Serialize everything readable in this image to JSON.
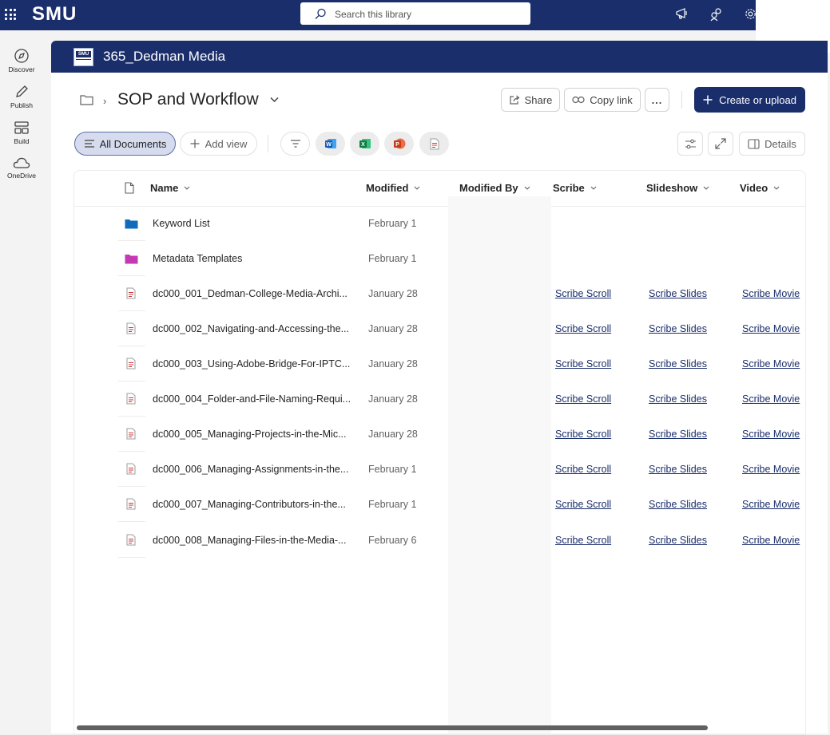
{
  "topbar": {
    "brand": "SMU",
    "search_placeholder": "Search this library",
    "icons": [
      "app-launcher-icon",
      "megaphone-icon",
      "share-people-icon",
      "gear-icon"
    ]
  },
  "leftrail": {
    "items": [
      {
        "label": "Discover",
        "icon": "compass-icon"
      },
      {
        "label": "Publish",
        "icon": "pen-icon"
      },
      {
        "label": "Build",
        "icon": "layout-icon"
      },
      {
        "label": "OneDrive",
        "icon": "cloud-icon"
      }
    ]
  },
  "site": {
    "logo_text": "SMU",
    "title": "365_Dedman Media"
  },
  "breadcrumb": {
    "title": "SOP and Workflow"
  },
  "actions": {
    "share": "Share",
    "copy_link": "Copy link",
    "more": "...",
    "create": "Create or upload"
  },
  "views": {
    "active": "All Documents",
    "add": "Add view",
    "details": "Details"
  },
  "table": {
    "headers": {
      "name": "Name",
      "modified": "Modified",
      "modified_by": "Modified By",
      "scribe": "Scribe",
      "slideshow": "Slideshow",
      "video": "Video"
    },
    "rows": [
      {
        "type": "folder",
        "color": "#0f6cbd",
        "name": "Keyword List",
        "modified": "February 1",
        "scribe": "",
        "slides": "",
        "video": ""
      },
      {
        "type": "folder",
        "color": "#c239b3",
        "name": "Metadata Templates",
        "modified": "February 1",
        "scribe": "",
        "slides": "",
        "video": ""
      },
      {
        "type": "pdf",
        "name": "dc000_001_Dedman-College-Media-Archi...",
        "modified": "January 28",
        "scribe": "Scribe Scroll",
        "slides": "Scribe Slides",
        "video": "Scribe Movie"
      },
      {
        "type": "pdf",
        "name": "dc000_002_Navigating-and-Accessing-the...",
        "modified": "January 28",
        "scribe": "Scribe Scroll",
        "slides": "Scribe Slides",
        "video": "Scribe Movie"
      },
      {
        "type": "pdf",
        "name": "dc000_003_Using-Adobe-Bridge-For-IPTC...",
        "modified": "January 28",
        "scribe": "Scribe Scroll",
        "slides": "Scribe Slides",
        "video": "Scribe Movie"
      },
      {
        "type": "pdf",
        "name": "dc000_004_Folder-and-File-Naming-Requi...",
        "modified": "January 28",
        "scribe": "Scribe Scroll",
        "slides": "Scribe Slides",
        "video": "Scribe Movie"
      },
      {
        "type": "pdf",
        "name": "dc000_005_Managing-Projects-in-the-Mic...",
        "modified": "January 28",
        "scribe": "Scribe Scroll",
        "slides": "Scribe Slides",
        "video": "Scribe Movie"
      },
      {
        "type": "pdf",
        "name": "dc000_006_Managing-Assignments-in-the...",
        "modified": "February 1",
        "scribe": "Scribe Scroll",
        "slides": "Scribe Slides",
        "video": "Scribe Movie"
      },
      {
        "type": "pdf",
        "name": "dc000_007_Managing-Contributors-in-the...",
        "modified": "February 1",
        "scribe": "Scribe Scroll",
        "slides": "Scribe Slides",
        "video": "Scribe Movie"
      },
      {
        "type": "pdf",
        "name": "dc000_008_Managing-Files-in-the-Media-...",
        "modified": "February 6",
        "scribe": "Scribe Scroll",
        "slides": "Scribe Slides",
        "video": "Scribe Movie"
      }
    ]
  },
  "colors": {
    "brand_navy": "#1a2e6b",
    "link": "#1a2e6b",
    "word": "#185abd",
    "excel": "#107c41",
    "powerpoint": "#c43e1c",
    "pdf": "#d13438"
  }
}
